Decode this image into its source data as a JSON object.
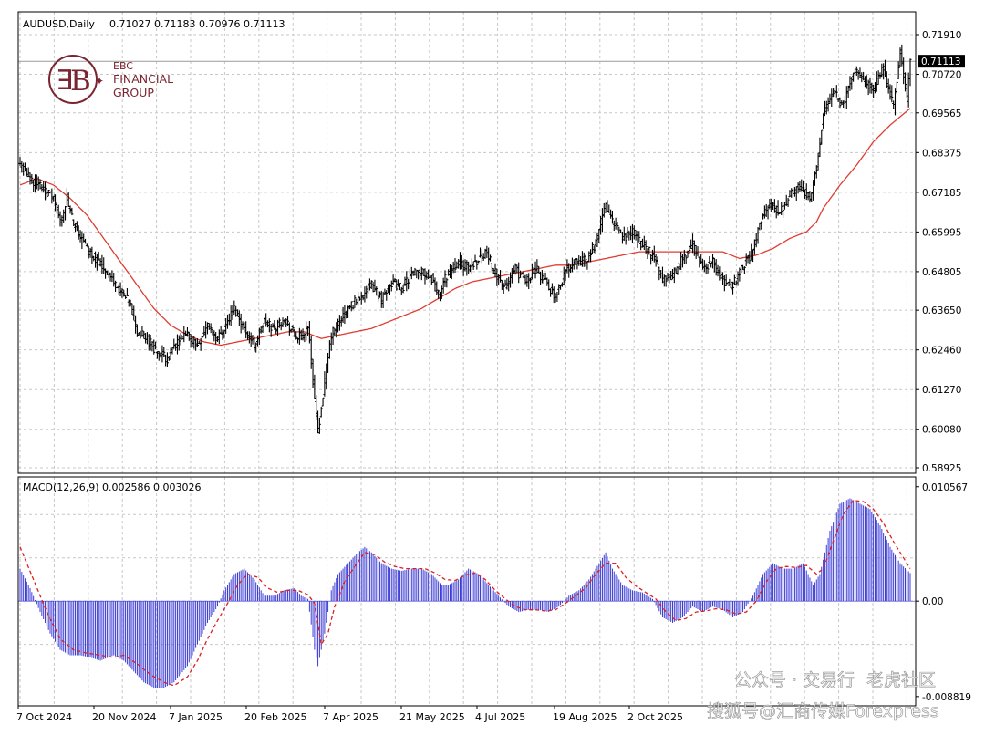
{
  "chart_data": [
    {
      "type": "candlestick",
      "symbol_header": "AUDUSD,Daily",
      "ohlc_header": "0.71027 0.71183 0.70976 0.71113",
      "last_price_label": "0.71113",
      "y_ticks": [
        "0.71910",
        "0.70720",
        "0.69565",
        "0.68375",
        "0.67185",
        "0.65995",
        "0.64805",
        "0.63650",
        "0.62460",
        "0.61270",
        "0.60080",
        "0.58925"
      ],
      "ylim": [
        0.58925,
        0.7191
      ],
      "x_ticks": [
        "7 Oct 2024",
        "20 Nov 2024",
        "7 Jan 2025",
        "20 Feb 2025",
        "7 Apr 2025",
        "21 May 2025",
        "4 Jul 2025",
        "19 Aug 2025",
        "2 Oct 2025"
      ],
      "close_anchors": [
        [
          0,
          0.68
        ],
        [
          6,
          0.676
        ],
        [
          14,
          0.673
        ],
        [
          20,
          0.67
        ],
        [
          24,
          0.663
        ],
        [
          28,
          0.67
        ],
        [
          32,
          0.662
        ],
        [
          40,
          0.655
        ],
        [
          52,
          0.648
        ],
        [
          60,
          0.642
        ],
        [
          66,
          0.638
        ],
        [
          70,
          0.63
        ],
        [
          76,
          0.628
        ],
        [
          82,
          0.624
        ],
        [
          88,
          0.622
        ],
        [
          94,
          0.627
        ],
        [
          100,
          0.629
        ],
        [
          106,
          0.626
        ],
        [
          112,
          0.632
        ],
        [
          118,
          0.628
        ],
        [
          124,
          0.633
        ],
        [
          128,
          0.637
        ],
        [
          134,
          0.631
        ],
        [
          140,
          0.626
        ],
        [
          146,
          0.633
        ],
        [
          152,
          0.631
        ],
        [
          158,
          0.634
        ],
        [
          164,
          0.629
        ],
        [
          168,
          0.628
        ],
        [
          172,
          0.632
        ],
        [
          176,
          0.61
        ],
        [
          178,
          0.6
        ],
        [
          182,
          0.615
        ],
        [
          186,
          0.629
        ],
        [
          192,
          0.634
        ],
        [
          198,
          0.638
        ],
        [
          204,
          0.641
        ],
        [
          210,
          0.644
        ],
        [
          216,
          0.64
        ],
        [
          222,
          0.645
        ],
        [
          228,
          0.643
        ],
        [
          234,
          0.647
        ],
        [
          240,
          0.648
        ],
        [
          246,
          0.646
        ],
        [
          250,
          0.641
        ],
        [
          256,
          0.648
        ],
        [
          262,
          0.651
        ],
        [
          268,
          0.649
        ],
        [
          274,
          0.652
        ],
        [
          278,
          0.654
        ],
        [
          284,
          0.648
        ],
        [
          290,
          0.643
        ],
        [
          296,
          0.649
        ],
        [
          302,
          0.645
        ],
        [
          308,
          0.649
        ],
        [
          314,
          0.645
        ],
        [
          320,
          0.641
        ],
        [
          326,
          0.648
        ],
        [
          332,
          0.652
        ],
        [
          338,
          0.651
        ],
        [
          344,
          0.657
        ],
        [
          350,
          0.668
        ],
        [
          354,
          0.663
        ],
        [
          360,
          0.658
        ],
        [
          366,
          0.66
        ],
        [
          372,
          0.656
        ],
        [
          378,
          0.653
        ],
        [
          384,
          0.646
        ],
        [
          390,
          0.647
        ],
        [
          396,
          0.652
        ],
        [
          402,
          0.656
        ],
        [
          408,
          0.649
        ],
        [
          414,
          0.651
        ],
        [
          420,
          0.645
        ],
        [
          426,
          0.644
        ],
        [
          432,
          0.65
        ],
        [
          438,
          0.654
        ],
        [
          442,
          0.663
        ],
        [
          448,
          0.668
        ],
        [
          454,
          0.666
        ],
        [
          460,
          0.671
        ],
        [
          466,
          0.674
        ],
        [
          472,
          0.67
        ],
        [
          476,
          0.68
        ],
        [
          480,
          0.695
        ],
        [
          486,
          0.702
        ],
        [
          492,
          0.698
        ],
        [
          498,
          0.708
        ],
        [
          504,
          0.706
        ],
        [
          510,
          0.703
        ],
        [
          516,
          0.709
        ],
        [
          522,
          0.697
        ],
        [
          526,
          0.714
        ],
        [
          530,
          0.7
        ],
        [
          532,
          0.7111
        ]
      ],
      "ma_anchors": [
        [
          0,
          0.674
        ],
        [
          10,
          0.676
        ],
        [
          20,
          0.674
        ],
        [
          30,
          0.67
        ],
        [
          40,
          0.665
        ],
        [
          50,
          0.658
        ],
        [
          60,
          0.651
        ],
        [
          70,
          0.644
        ],
        [
          80,
          0.637
        ],
        [
          90,
          0.632
        ],
        [
          100,
          0.629
        ],
        [
          110,
          0.627
        ],
        [
          120,
          0.626
        ],
        [
          130,
          0.627
        ],
        [
          140,
          0.628
        ],
        [
          150,
          0.629
        ],
        [
          160,
          0.63
        ],
        [
          170,
          0.63
        ],
        [
          180,
          0.628
        ],
        [
          190,
          0.629
        ],
        [
          200,
          0.63
        ],
        [
          210,
          0.631
        ],
        [
          220,
          0.633
        ],
        [
          230,
          0.635
        ],
        [
          240,
          0.637
        ],
        [
          250,
          0.64
        ],
        [
          260,
          0.643
        ],
        [
          270,
          0.645
        ],
        [
          280,
          0.646
        ],
        [
          290,
          0.647
        ],
        [
          300,
          0.648
        ],
        [
          310,
          0.649
        ],
        [
          320,
          0.65
        ],
        [
          330,
          0.65
        ],
        [
          340,
          0.651
        ],
        [
          350,
          0.652
        ],
        [
          360,
          0.653
        ],
        [
          370,
          0.654
        ],
        [
          380,
          0.654
        ],
        [
          390,
          0.654
        ],
        [
          400,
          0.654
        ],
        [
          410,
          0.654
        ],
        [
          420,
          0.654
        ],
        [
          430,
          0.652
        ],
        [
          440,
          0.653
        ],
        [
          450,
          0.655
        ],
        [
          460,
          0.658
        ],
        [
          470,
          0.66
        ],
        [
          476,
          0.663
        ],
        [
          480,
          0.667
        ],
        [
          490,
          0.674
        ],
        [
          500,
          0.68
        ],
        [
          510,
          0.687
        ],
        [
          520,
          0.692
        ],
        [
          532,
          0.697
        ]
      ],
      "seed": 11
    },
    {
      "type": "bar",
      "header": "MACD(12,26,9) 0.002586 0.003026",
      "y_ticks": [
        "0.010567",
        "0.00",
        "-0.008819"
      ],
      "ylim": [
        -0.009,
        0.0108
      ],
      "macd_anchors": [
        [
          0,
          0.003
        ],
        [
          6,
          0.0012
        ],
        [
          12,
          -0.001
        ],
        [
          18,
          -0.003
        ],
        [
          24,
          -0.0045
        ],
        [
          30,
          -0.005
        ],
        [
          36,
          -0.005
        ],
        [
          42,
          -0.0052
        ],
        [
          48,
          -0.0055
        ],
        [
          56,
          -0.005
        ],
        [
          62,
          -0.0055
        ],
        [
          68,
          -0.0065
        ],
        [
          74,
          -0.0075
        ],
        [
          80,
          -0.008
        ],
        [
          86,
          -0.008
        ],
        [
          92,
          -0.0075
        ],
        [
          100,
          -0.006
        ],
        [
          106,
          -0.004
        ],
        [
          112,
          -0.002
        ],
        [
          118,
          -0.0005
        ],
        [
          122,
          0.001
        ],
        [
          128,
          0.0025
        ],
        [
          134,
          0.003
        ],
        [
          140,
          0.002
        ],
        [
          146,
          0.0005
        ],
        [
          152,
          0.0005
        ],
        [
          158,
          0.001
        ],
        [
          164,
          0.0012
        ],
        [
          168,
          0.0005
        ],
        [
          172,
          0.0002
        ],
        [
          176,
          -0.0045
        ],
        [
          178,
          -0.006
        ],
        [
          182,
          -0.003
        ],
        [
          186,
          0.001
        ],
        [
          190,
          0.0025
        ],
        [
          196,
          0.0035
        ],
        [
          202,
          0.0045
        ],
        [
          206,
          0.005
        ],
        [
          210,
          0.0045
        ],
        [
          216,
          0.0035
        ],
        [
          222,
          0.003
        ],
        [
          228,
          0.0028
        ],
        [
          234,
          0.003
        ],
        [
          240,
          0.003
        ],
        [
          246,
          0.0025
        ],
        [
          252,
          0.0015
        ],
        [
          256,
          0.0015
        ],
        [
          262,
          0.002
        ],
        [
          268,
          0.003
        ],
        [
          274,
          0.0025
        ],
        [
          280,
          0.0015
        ],
        [
          286,
          0.0005
        ],
        [
          292,
          -0.0005
        ],
        [
          298,
          -0.001
        ],
        [
          304,
          -0.0008
        ],
        [
          310,
          -0.0008
        ],
        [
          316,
          -0.001
        ],
        [
          322,
          -0.0005
        ],
        [
          328,
          0.0005
        ],
        [
          334,
          0.001
        ],
        [
          340,
          0.002
        ],
        [
          346,
          0.0035
        ],
        [
          350,
          0.0045
        ],
        [
          354,
          0.003
        ],
        [
          360,
          0.0015
        ],
        [
          366,
          0.001
        ],
        [
          372,
          0.0008
        ],
        [
          378,
          0.0002
        ],
        [
          384,
          -0.0015
        ],
        [
          390,
          -0.002
        ],
        [
          396,
          -0.0015
        ],
        [
          402,
          -0.0005
        ],
        [
          408,
          -0.001
        ],
        [
          414,
          -0.0005
        ],
        [
          420,
          -0.0008
        ],
        [
          426,
          -0.0015
        ],
        [
          432,
          -0.001
        ],
        [
          438,
          0.0005
        ],
        [
          444,
          0.0025
        ],
        [
          450,
          0.0035
        ],
        [
          456,
          0.003
        ],
        [
          462,
          0.003
        ],
        [
          468,
          0.0035
        ],
        [
          474,
          0.0015
        ],
        [
          478,
          0.0025
        ],
        [
          484,
          0.0065
        ],
        [
          490,
          0.009
        ],
        [
          496,
          0.0095
        ],
        [
          502,
          0.009
        ],
        [
          508,
          0.0085
        ],
        [
          514,
          0.007
        ],
        [
          520,
          0.005
        ],
        [
          526,
          0.0035
        ],
        [
          532,
          0.0026
        ]
      ],
      "signal_anchors": [
        [
          0,
          0.005
        ],
        [
          8,
          0.002
        ],
        [
          16,
          -0.001
        ],
        [
          24,
          -0.0035
        ],
        [
          32,
          -0.0045
        ],
        [
          40,
          -0.0048
        ],
        [
          48,
          -0.005
        ],
        [
          56,
          -0.0052
        ],
        [
          62,
          -0.005
        ],
        [
          70,
          -0.0058
        ],
        [
          78,
          -0.0068
        ],
        [
          86,
          -0.0075
        ],
        [
          92,
          -0.0078
        ],
        [
          100,
          -0.007
        ],
        [
          106,
          -0.0055
        ],
        [
          112,
          -0.0035
        ],
        [
          118,
          -0.0018
        ],
        [
          124,
          -0.0002
        ],
        [
          130,
          0.0015
        ],
        [
          136,
          0.0025
        ],
        [
          142,
          0.0022
        ],
        [
          148,
          0.0012
        ],
        [
          154,
          0.0008
        ],
        [
          160,
          0.001
        ],
        [
          166,
          0.001
        ],
        [
          172,
          0.0006
        ],
        [
          176,
          -0.0002
        ],
        [
          180,
          -0.004
        ],
        [
          184,
          -0.003
        ],
        [
          188,
          -0.0005
        ],
        [
          194,
          0.0018
        ],
        [
          200,
          0.0032
        ],
        [
          206,
          0.0045
        ],
        [
          212,
          0.0043
        ],
        [
          218,
          0.0036
        ],
        [
          224,
          0.0032
        ],
        [
          230,
          0.003
        ],
        [
          236,
          0.003
        ],
        [
          242,
          0.003
        ],
        [
          248,
          0.0026
        ],
        [
          254,
          0.002
        ],
        [
          260,
          0.0019
        ],
        [
          266,
          0.0024
        ],
        [
          272,
          0.0026
        ],
        [
          278,
          0.002
        ],
        [
          284,
          0.001
        ],
        [
          290,
          0.0002
        ],
        [
          296,
          -0.0005
        ],
        [
          302,
          -0.0008
        ],
        [
          308,
          -0.0008
        ],
        [
          314,
          -0.0009
        ],
        [
          320,
          -0.0008
        ],
        [
          326,
          -0.0002
        ],
        [
          332,
          0.0005
        ],
        [
          338,
          0.0012
        ],
        [
          344,
          0.0025
        ],
        [
          350,
          0.0035
        ],
        [
          356,
          0.0035
        ],
        [
          362,
          0.0022
        ],
        [
          368,
          0.0014
        ],
        [
          374,
          0.0008
        ],
        [
          380,
          0.0002
        ],
        [
          386,
          -0.001
        ],
        [
          392,
          -0.0018
        ],
        [
          398,
          -0.0016
        ],
        [
          404,
          -0.001
        ],
        [
          410,
          -0.0009
        ],
        [
          416,
          -0.0007
        ],
        [
          422,
          -0.0008
        ],
        [
          428,
          -0.0012
        ],
        [
          434,
          -0.001
        ],
        [
          440,
          0.0
        ],
        [
          446,
          0.0018
        ],
        [
          452,
          0.003
        ],
        [
          458,
          0.0032
        ],
        [
          464,
          0.0031
        ],
        [
          470,
          0.0033
        ],
        [
          476,
          0.0025
        ],
        [
          480,
          0.003
        ],
        [
          486,
          0.0055
        ],
        [
          492,
          0.008
        ],
        [
          498,
          0.0093
        ],
        [
          504,
          0.0092
        ],
        [
          510,
          0.0085
        ],
        [
          516,
          0.0072
        ],
        [
          522,
          0.0055
        ],
        [
          528,
          0.004
        ],
        [
          532,
          0.003
        ]
      ]
    }
  ],
  "logo": {
    "line1": "EBC",
    "line2": "FINANCIAL",
    "line3": "GROUP"
  },
  "watermarks": [
    "公众号 · 交易行",
    "老虎社区",
    "搜狐号@汇商传媒Forexpress"
  ],
  "colors": {
    "candle": "#000000",
    "ma": "#e03c32",
    "macd_bar": "#3b3bd6",
    "signal": "#dd2020",
    "grid": "#c7c7c7",
    "logo": "#7a2530"
  }
}
